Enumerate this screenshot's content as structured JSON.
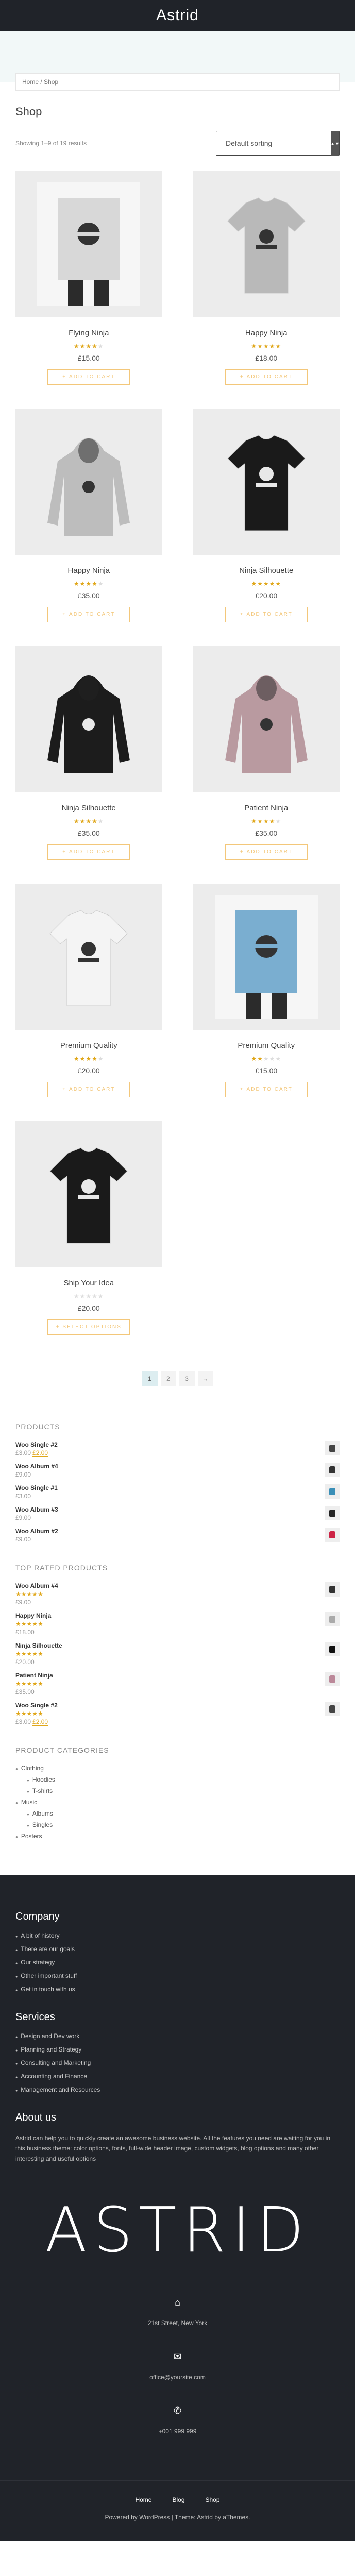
{
  "site": {
    "title": "Astrid"
  },
  "breadcrumb": "Home / Shop",
  "shop": {
    "title": "Shop",
    "result_count": "Showing 1–9 of 19 results",
    "ordering": "Default sorting",
    "add_to_cart": "Add to cart",
    "select_options": "Select options"
  },
  "products": [
    {
      "name": "Flying Ninja",
      "price": "£15.00",
      "rating": 4,
      "image": "poster-ninja-icon"
    },
    {
      "name": "Happy Ninja",
      "price": "£18.00",
      "rating": 5,
      "image": "tshirt-grey-icon"
    },
    {
      "name": "Happy Ninja",
      "price": "£35.00",
      "rating": 4,
      "image": "hoodie-grey-icon"
    },
    {
      "name": "Ninja Silhouette",
      "price": "£20.00",
      "rating": 5,
      "image": "tshirt-black-icon"
    },
    {
      "name": "Ninja Silhouette",
      "price": "£35.00",
      "rating": 4,
      "image": "hoodie-black-icon"
    },
    {
      "name": "Patient Ninja",
      "price": "£35.00",
      "rating": 4,
      "image": "hoodie-mauve-icon"
    },
    {
      "name": "Premium Quality",
      "price": "£20.00",
      "rating": 4,
      "image": "tshirt-white-icon"
    },
    {
      "name": "Premium Quality",
      "price": "£15.00",
      "rating": 2,
      "image": "poster-blue-icon"
    },
    {
      "name": "Ship Your Idea",
      "price": "£20.00",
      "rating": 0,
      "image": "tshirt-skull-icon"
    }
  ],
  "pagination": [
    "1",
    "2",
    "3",
    "→"
  ],
  "widgets": {
    "products_title": "Products",
    "products": [
      {
        "name": "Woo Single #2",
        "old": "£3.00",
        "price": "£2.00",
        "thumb": "#444"
      },
      {
        "name": "Woo Album #4",
        "price": "£9.00",
        "thumb": "#333"
      },
      {
        "name": "Woo Single #1",
        "price": "£3.00",
        "thumb": "#3a8fb7"
      },
      {
        "name": "Woo Album #3",
        "price": "£9.00",
        "thumb": "#222"
      },
      {
        "name": "Woo Album #2",
        "price": "£9.00",
        "thumb": "#c24"
      }
    ],
    "top_title": "Top Rated Products",
    "top": [
      {
        "name": "Woo Album #4",
        "price": "£9.00",
        "rating": 5,
        "thumb": "#333"
      },
      {
        "name": "Happy Ninja",
        "price": "£18.00",
        "rating": 5,
        "thumb": "#aaa"
      },
      {
        "name": "Ninja Silhouette",
        "price": "£20.00",
        "rating": 5,
        "thumb": "#111"
      },
      {
        "name": "Patient Ninja",
        "price": "£35.00",
        "rating": 5,
        "thumb": "#b89"
      },
      {
        "name": "Woo Single #2",
        "old": "£3.00",
        "price": "£2.00",
        "rating": 5,
        "thumb": "#444"
      }
    ],
    "cat_title": "Product Categories",
    "categories": [
      {
        "name": "Clothing",
        "child": false
      },
      {
        "name": "Hoodies",
        "child": true
      },
      {
        "name": "T-shirts",
        "child": true
      },
      {
        "name": "Music",
        "child": false
      },
      {
        "name": "Albums",
        "child": true
      },
      {
        "name": "Singles",
        "child": true
      },
      {
        "name": "Posters",
        "child": false
      }
    ]
  },
  "footer": {
    "company_title": "Company",
    "company": [
      "A bit of history",
      "There are our goals",
      "Our strategy",
      "Other important stuff",
      "Get in touch with us"
    ],
    "services_title": "Services",
    "services": [
      "Design and Dev work",
      "Planning and Strategy",
      "Consulting and Marketing",
      "Accounting and Finance",
      "Management and Resources"
    ],
    "about_title": "About us",
    "about_text": "Astrid can help you to quickly create an awesome business website. All the features you need are waiting for you in this business theme: color options, fonts, full-wide header image, custom widgets, blog options and many other interesting and useful options",
    "logo": "ASTRID",
    "address": "21st Street, New York",
    "email": "office@yoursite.com",
    "phone": "+001 999 999",
    "nav": [
      "Home",
      "Blog",
      "Shop"
    ],
    "credits": "Powered by WordPress | Theme: Astrid by aThemes."
  },
  "colors": {
    "header": "#202329",
    "accent": "#f3c77a",
    "stars": "#e0a71a"
  }
}
